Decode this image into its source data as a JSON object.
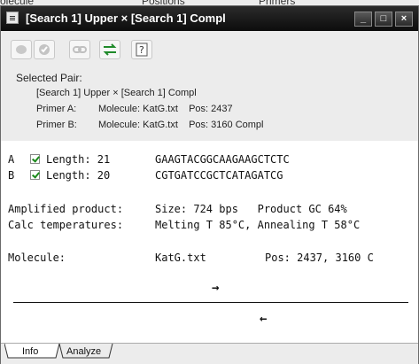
{
  "background_tabs": [
    "olecule",
    "Positions",
    "Primers"
  ],
  "window": {
    "title": "[Search 1] Upper × [Search 1] Compl",
    "controls": {
      "minimize": "_",
      "maximize": "□",
      "close": "×"
    }
  },
  "toolbar": {
    "buttons": [
      {
        "name": "record-icon",
        "enabled": false
      },
      {
        "name": "check-icon",
        "enabled": false
      },
      {
        "name": "link-icon",
        "enabled": false
      },
      {
        "name": "swap-arrows-icon",
        "enabled": true
      },
      {
        "name": "help-icon",
        "enabled": true
      }
    ]
  },
  "selected": {
    "heading": "Selected Pair:",
    "pair_name": "[Search 1] Upper × [Search 1] Compl",
    "primer_a_label": "Primer A:",
    "primer_a_value": "Molecule: KatG.txt    Pos: 2437",
    "primer_b_label": "Primer B:",
    "primer_b_value": "Molecule: KatG.txt    Pos: 3160 Compl"
  },
  "primers": [
    {
      "id": "A",
      "checked": true,
      "length": "Length: 21",
      "seq": "GAAGTACGGCAAGAAGCTCTC"
    },
    {
      "id": "B",
      "checked": true,
      "length": "Length: 20",
      "seq": "CGTGATCCGCTCATAGATCG"
    }
  ],
  "product": {
    "line1_label": "Amplified product:",
    "line1_value": "Size: 724 bps   Product GC 64%",
    "line2_label": "Calc temperatures:",
    "line2_value": "Melting T 85°C, Annealing T 58°C",
    "molecule_label": "Molecule:",
    "molecule_value": "KatG.txt",
    "pos_value": "Pos: 2437, 3160 C"
  },
  "diagram": {
    "forward_arrow": "→",
    "reverse_arrow": "←"
  },
  "tabs": [
    {
      "label": "Info",
      "active": true
    },
    {
      "label": "Analyze",
      "active": false
    }
  ]
}
